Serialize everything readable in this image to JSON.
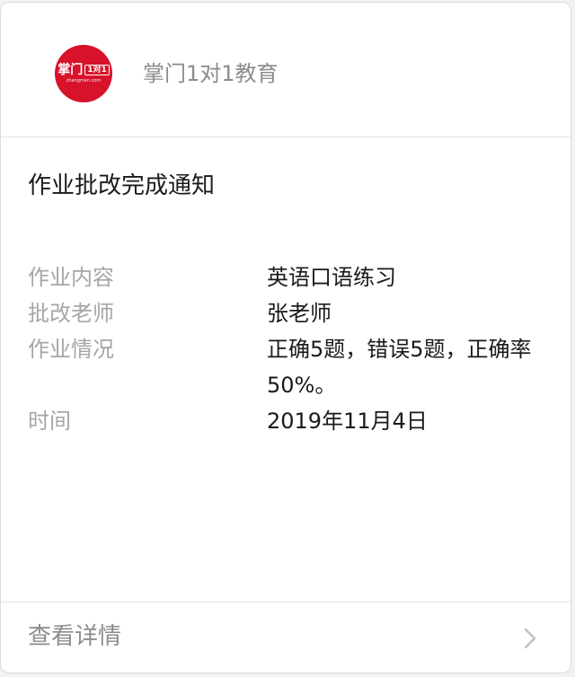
{
  "header": {
    "logo": {
      "main_text": "掌门",
      "box_text": "1对1",
      "domain_text": "zhangmen.com",
      "color": "#d7122a"
    },
    "org_name": "掌门1对1教育"
  },
  "notice": {
    "title": "作业批改完成通知",
    "rows": [
      {
        "label": "作业内容",
        "value": "英语口语练习"
      },
      {
        "label": "批改老师",
        "value": "张老师"
      },
      {
        "label": "作业情况",
        "value": "正确5题，错误5题，正确率50%。"
      },
      {
        "label": "时间",
        "value": "2019年11月4日"
      }
    ]
  },
  "footer": {
    "detail_label": "查看详情",
    "icon": "chevron-right-icon"
  }
}
